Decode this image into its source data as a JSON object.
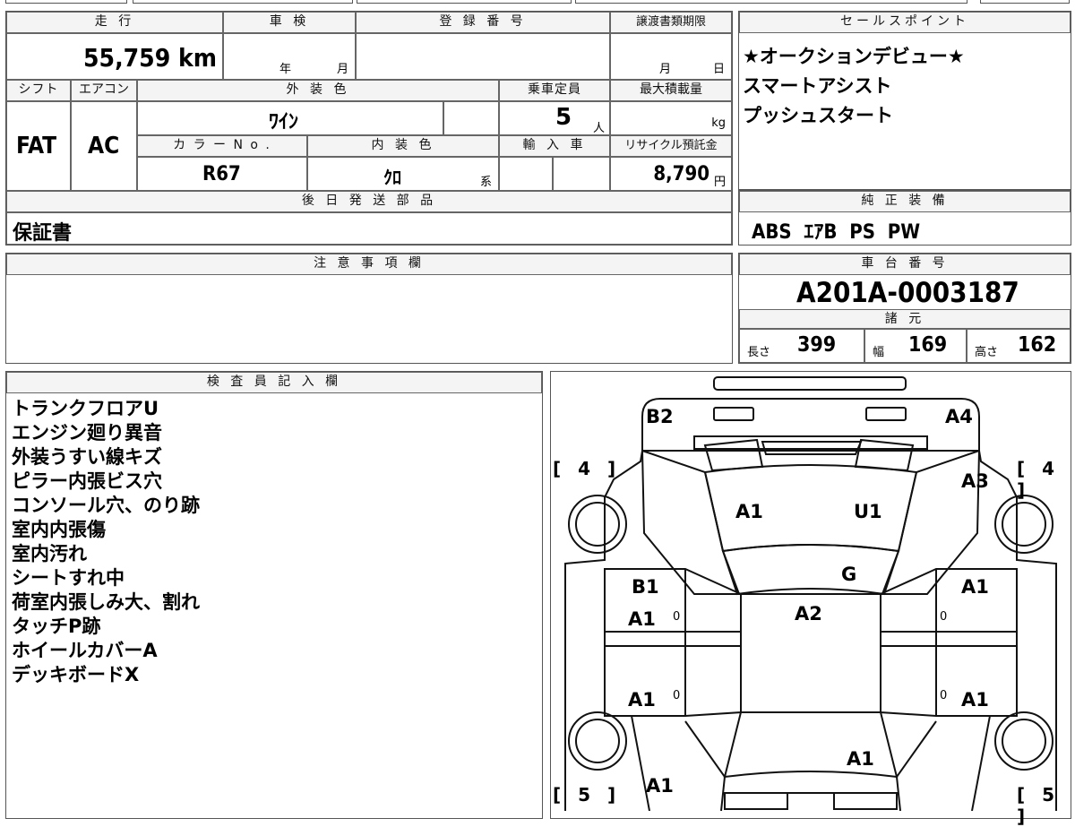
{
  "vehicle": {
    "hdr_mileage": "走 行",
    "hdr_inspection": "車 検",
    "hdr_registration": "登 録 番 号",
    "hdr_transfer": "譲渡書類期限",
    "mileage": "55,759 km",
    "inspection_year": "年",
    "inspection_month": "月",
    "transfer_month": "月",
    "transfer_day": "日",
    "hdr_shift": "シフト",
    "hdr_aircon": "エアコン",
    "hdr_exterior": "外 装 色",
    "hdr_capacity": "乗車定員",
    "hdr_maxload": "最大積載量",
    "shift": "FAT",
    "aircon": "AC",
    "exterior_color": "ﾜｲﾝ",
    "capacity": "5",
    "capacity_unit": "人",
    "maxload_unit": "kg",
    "hdr_colorno": "カ ラ ー N o .",
    "hdr_interior": "内 装 色",
    "hdr_import": "輸 入 車",
    "hdr_recycle": "リサイクル預託金",
    "color_no": "R67",
    "interior_color": "ｸﾛ",
    "interior_suffix": "系",
    "recycle_fee": "8,790",
    "recycle_unit": "円",
    "hdr_later_parts": "後 日 発 送 部 品",
    "later_parts": "保証書"
  },
  "sales": {
    "header": "セールスポイント",
    "lines": [
      "★オークションデビュー★",
      "スマートアシスト",
      "プッシュスタート"
    ]
  },
  "equipment": {
    "header": "純 正 装 備",
    "value": "ABS  ｴｱB  PS  PW"
  },
  "notes": {
    "header": "注 意 事 項 欄"
  },
  "chassis": {
    "header": "車 台 番 号",
    "value": "A201A-0003187",
    "spec_header": "諸 元",
    "length_label": "長さ",
    "length": "399",
    "width_label": "幅",
    "width": "169",
    "height_label": "高さ",
    "height": "162"
  },
  "inspector": {
    "header": "検 査 員 記 入 欄",
    "lines": [
      "トランクフロアU",
      "エンジン廻り異音",
      "外装うすい線キズ",
      "ピラー内張ビス穴",
      "コンソール穴、のり跡",
      "室内内張傷",
      "室内汚れ",
      "シートすれ中",
      "荷室内張しみ大、割れ",
      "タッチP跡",
      "ホイールカバーA",
      "デッキボードX"
    ]
  },
  "diagram": {
    "labels": {
      "b2": "B2",
      "a4": "A4",
      "a3": "A3",
      "a1_hood_left": "A1",
      "u1": "U1",
      "g": "G",
      "b1": "B1",
      "a1_front_door_left": "A1",
      "a2": "A2",
      "a1_front_door_right": "A1",
      "a1_rear_door_left": "A1",
      "a1_rear_door_right": "A1",
      "a1_rear_right": "A1",
      "a1_rear_left": "A1"
    },
    "tire_front_left": "[ 4 ]",
    "tire_front_right": "[ 4 ]",
    "tire_rear_left": "[ 5 ]",
    "tire_rear_right": "[ 5 ]",
    "zero_marks": [
      "0",
      "0",
      "0",
      "0"
    ]
  }
}
